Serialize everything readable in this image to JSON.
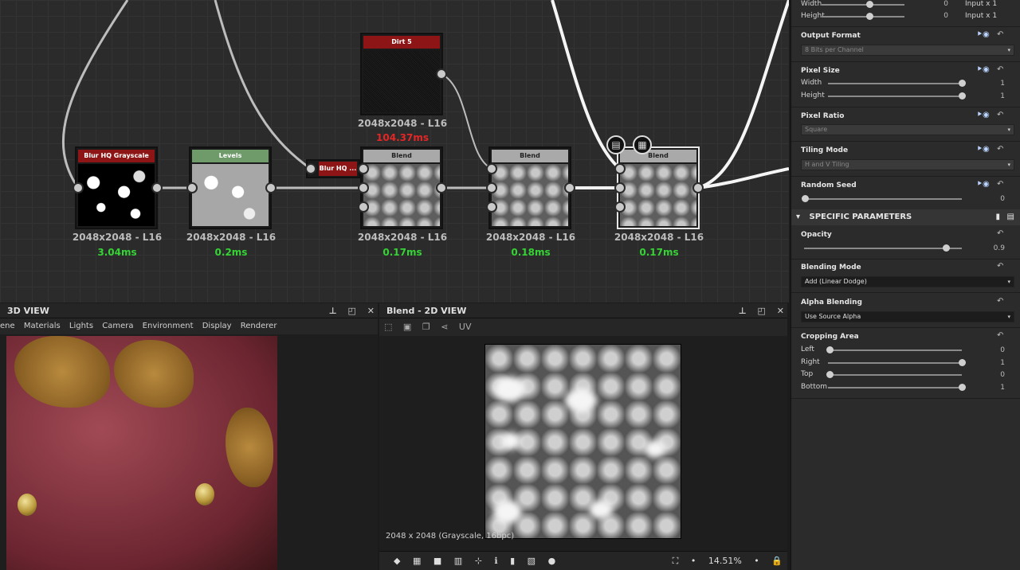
{
  "graph": {
    "nodes": [
      {
        "title": "Blur HQ Grayscale",
        "res": "2048x2048 - L16",
        "time": "3.04ms"
      },
      {
        "title": "Levels",
        "res": "2048x2048 - L16",
        "time": "0.2ms"
      },
      {
        "title": "Dirt 5",
        "res": "2048x2048 - L16",
        "time": "104.37ms"
      },
      {
        "title": "Blend",
        "res": "2048x2048 - L16",
        "time": "0.17ms"
      },
      {
        "title": "Blend",
        "res": "2048x2048 - L16",
        "time": "0.18ms"
      },
      {
        "title": "Blend",
        "res": "2048x2048 - L16",
        "time": "0.17ms"
      }
    ],
    "mini_node": "Blur HQ ..."
  },
  "view3d": {
    "title": "3D VIEW",
    "menu": [
      "ene",
      "Materials",
      "Lights",
      "Camera",
      "Environment",
      "Display",
      "Renderer"
    ]
  },
  "view2d": {
    "title": "Blend - 2D VIEW",
    "uv": "UV",
    "info": "2048 x 2048 (Grayscale, 16bpc)",
    "zoom": "14.51%"
  },
  "props": {
    "top": {
      "width_label": "Width",
      "width_val": "0",
      "width_ref": "Input x 1",
      "height_label": "Height",
      "height_val": "0",
      "height_ref": "Input x 1"
    },
    "output_format": {
      "label": "Output Format",
      "value": "8 Bits per Channel"
    },
    "pixel_size": {
      "label": "Pixel Size",
      "width_label": "Width",
      "width_val": "1",
      "height_label": "Height",
      "height_val": "1"
    },
    "pixel_ratio": {
      "label": "Pixel Ratio",
      "value": "Square"
    },
    "tiling": {
      "label": "Tiling Mode",
      "value": "H and V Tiling"
    },
    "seed": {
      "label": "Random Seed",
      "value": "0"
    },
    "specific": "SPECIFIC PARAMETERS",
    "opacity": {
      "label": "Opacity",
      "value": "0.9",
      "fraction": 0.9
    },
    "blending": {
      "label": "Blending Mode",
      "value": "Add (Linear Dodge)"
    },
    "alpha": {
      "label": "Alpha Blending",
      "value": "Use Source Alpha"
    },
    "crop": {
      "label": "Cropping Area",
      "left": "Left",
      "left_val": "0",
      "right": "Right",
      "right_val": "1",
      "top": "Top",
      "top_val": "0",
      "bottom": "Bottom",
      "bottom_val": "1"
    }
  }
}
